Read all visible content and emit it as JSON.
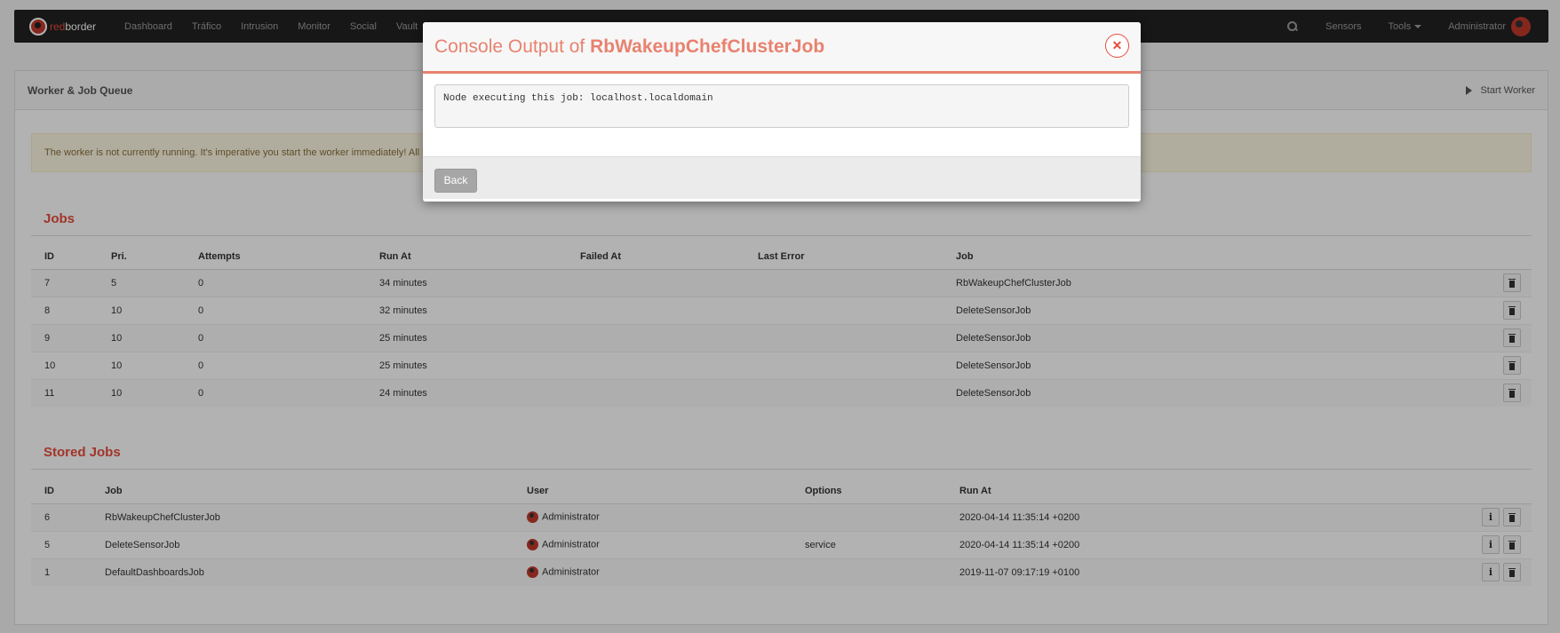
{
  "navbar": {
    "brand_red": "red",
    "brand_white": "border",
    "items": [
      "Dashboard",
      "Tráfico",
      "Intrusion",
      "Monitor",
      "Social",
      "Vault"
    ],
    "sensors": "Sensors",
    "tools": "Tools",
    "user": "Administrator"
  },
  "panel": {
    "title": "Worker & Job Queue",
    "start_worker": "Start Worker",
    "alert": "The worker is not currently running. It's imperative you start the worker immediately! All ba"
  },
  "jobs": {
    "title": "Jobs",
    "headers": [
      "ID",
      "Pri.",
      "Attempts",
      "Run At",
      "Failed At",
      "Last Error",
      "Job"
    ],
    "rows": [
      {
        "id": "7",
        "pri": "5",
        "attempts": "0",
        "run_at": "34 minutes",
        "failed_at": "",
        "last_error": "",
        "job": "RbWakeupChefClusterJob"
      },
      {
        "id": "8",
        "pri": "10",
        "attempts": "0",
        "run_at": "32 minutes",
        "failed_at": "",
        "last_error": "",
        "job": "DeleteSensorJob"
      },
      {
        "id": "9",
        "pri": "10",
        "attempts": "0",
        "run_at": "25 minutes",
        "failed_at": "",
        "last_error": "",
        "job": "DeleteSensorJob"
      },
      {
        "id": "10",
        "pri": "10",
        "attempts": "0",
        "run_at": "25 minutes",
        "failed_at": "",
        "last_error": "",
        "job": "DeleteSensorJob"
      },
      {
        "id": "11",
        "pri": "10",
        "attempts": "0",
        "run_at": "24 minutes",
        "failed_at": "",
        "last_error": "",
        "job": "DeleteSensorJob"
      }
    ]
  },
  "stored_jobs": {
    "title": "Stored Jobs",
    "headers": [
      "ID",
      "Job",
      "User",
      "Options",
      "Run At"
    ],
    "rows": [
      {
        "id": "6",
        "job": "RbWakeupChefClusterJob",
        "user": "Administrator",
        "options": "",
        "run_at": "2020-04-14 11:35:14 +0200"
      },
      {
        "id": "5",
        "job": "DeleteSensorJob",
        "user": "Administrator",
        "options": "service",
        "run_at": "2020-04-14 11:35:14 +0200"
      },
      {
        "id": "1",
        "job": "DefaultDashboardsJob",
        "user": "Administrator",
        "options": "",
        "run_at": "2019-11-07 09:17:19 +0100"
      }
    ]
  },
  "modal": {
    "title_prefix": "Console Output of ",
    "title_job": "RbWakeupChefClusterJob",
    "console_text": "Node executing this job: localhost.localdomain",
    "back_label": "Back",
    "close_glyph": "✕"
  },
  "colors": {
    "accent": "#e74c3c",
    "navbar_bg": "#222222",
    "alert_bg": "#fcf8e3"
  }
}
